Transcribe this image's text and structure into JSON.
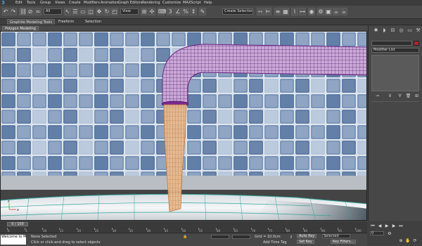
{
  "menubar": {
    "logo": "3",
    "items": [
      "Edit",
      "Tools",
      "Group",
      "Views",
      "Create",
      "Modifiers",
      "Animation",
      "Graph Editors",
      "Rendering",
      "Customize",
      "MAXScript",
      "Help"
    ]
  },
  "toolbar": {
    "selection_filter": "All",
    "reference_coord": "View",
    "named_selection_sets": "Create Selection Se"
  },
  "ribbon": {
    "tabs": [
      "Graphite Modeling Tools",
      "Freeform",
      "Selection"
    ],
    "panel_label": "Polygon Modeling"
  },
  "viewport": {
    "axis_x": "x",
    "axis_z": "z"
  },
  "command_panel": {
    "object_name": "",
    "modifier_list": "Modifier List"
  },
  "timeline": {
    "slider_label": "0 / 100",
    "ticks": [
      "0",
      "5",
      "10",
      "15",
      "20",
      "25",
      "30",
      "35",
      "40",
      "45",
      "50",
      "55",
      "60",
      "65",
      "70",
      "75",
      "80",
      "85",
      "90",
      "95",
      "100"
    ]
  },
  "status": {
    "listener": "Welcome to M.",
    "selection_status": "None Selected",
    "prompt": "Click or click-and-drag to select objects",
    "grid": "Grid = 10.0cm",
    "add_time_tag": "Add Time Tag",
    "auto_key": "Auto Key",
    "key_mode": "Selected",
    "set_key": "Set Key",
    "key_filters": "Key Filters...",
    "frame": "0"
  },
  "colors": {
    "object_swatch": "#b02030",
    "wire_purple": "#7a2a90",
    "water_orange": "#d08a50",
    "tile_blue": "#4f6f9d"
  }
}
